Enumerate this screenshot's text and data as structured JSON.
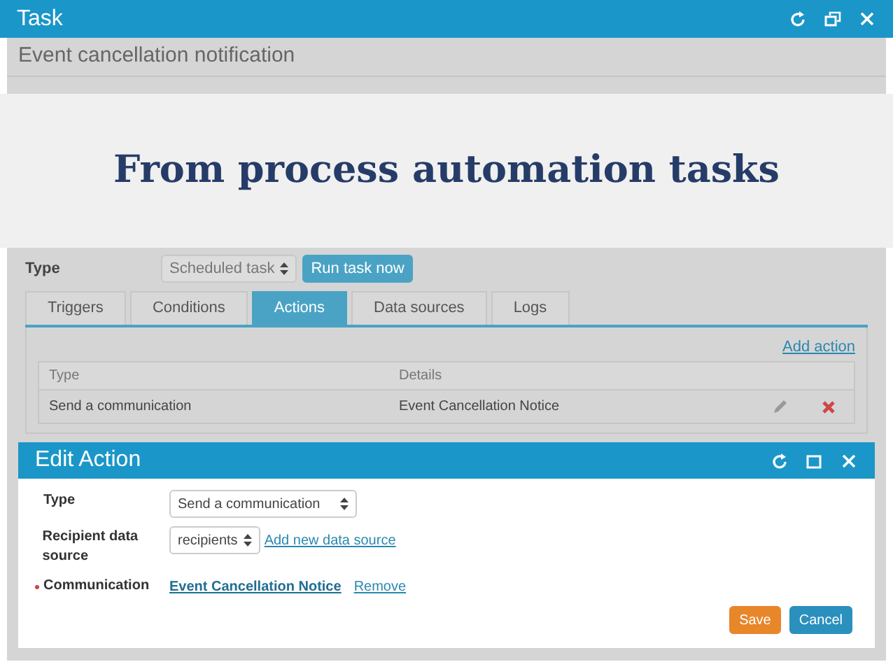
{
  "window": {
    "title": "Task"
  },
  "header": {
    "title": "Event cancellation notification"
  },
  "banner": {
    "text": "From process automation tasks"
  },
  "task": {
    "type_label": "Type",
    "type_value": "Scheduled task",
    "run_button": "Run task now",
    "tabs": [
      {
        "label": "Triggers",
        "selected": false
      },
      {
        "label": "Conditions",
        "selected": false
      },
      {
        "label": "Actions",
        "selected": true
      },
      {
        "label": "Data sources",
        "selected": false
      },
      {
        "label": "Logs",
        "selected": false
      }
    ],
    "add_action": "Add action",
    "table": {
      "columns": [
        "Type",
        "Details"
      ],
      "rows": [
        {
          "type": "Send a communication",
          "details": "Event Cancellation Notice"
        }
      ]
    }
  },
  "dialog": {
    "title": "Edit Action",
    "fields": [
      {
        "kind": "select",
        "label": "Type",
        "value": "Send a communication",
        "required": false
      },
      {
        "kind": "select",
        "label": "Recipient data source",
        "value": "recipients",
        "link": "Add new data source",
        "required": false
      },
      {
        "kind": "links",
        "label": "Communication",
        "value": "Event Cancellation Notice",
        "link": "Remove",
        "required": true
      }
    ],
    "buttons": [
      {
        "label": "Save",
        "kind": "primary"
      },
      {
        "label": "Cancel",
        "kind": "secondary"
      }
    ]
  }
}
